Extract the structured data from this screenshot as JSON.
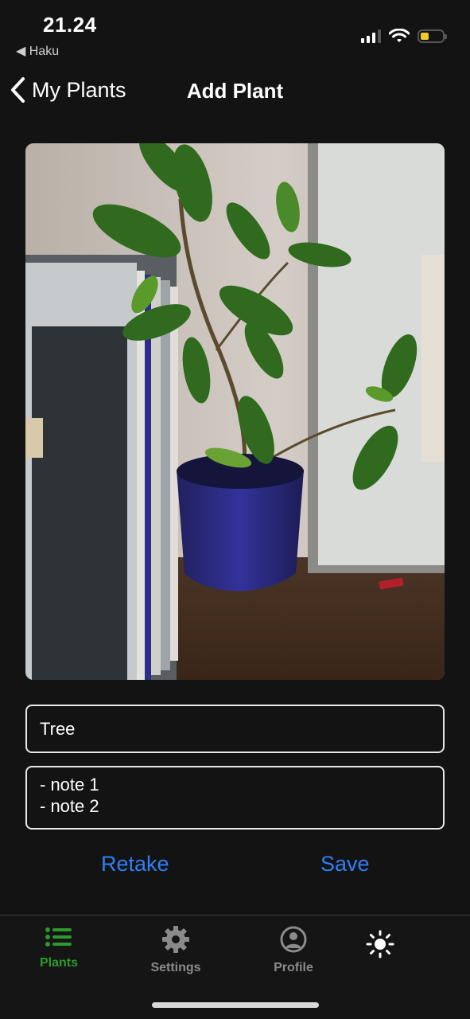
{
  "status_bar": {
    "time": "21.24",
    "back_app": "◀ Haku"
  },
  "nav": {
    "back_label": "My Plants",
    "title": "Add Plant"
  },
  "form": {
    "name_value": "Tree",
    "notes_value": "- note 1\n- note 2"
  },
  "actions": {
    "retake_label": "Retake",
    "save_label": "Save"
  },
  "tabs": [
    {
      "label": "Plants",
      "icon": "list-icon",
      "active": true
    },
    {
      "label": "Settings",
      "icon": "gear-icon",
      "active": false
    },
    {
      "label": "Profile",
      "icon": "user-circle-icon",
      "active": false
    },
    {
      "label": "",
      "icon": "sun-icon",
      "active": false
    }
  ],
  "colors": {
    "background": "#131313",
    "accent_blue": "#2f7ff5",
    "active_green": "#2c9a2c",
    "inactive_gray": "#8a8a8a",
    "battery_yellow": "#f2cb2a"
  }
}
